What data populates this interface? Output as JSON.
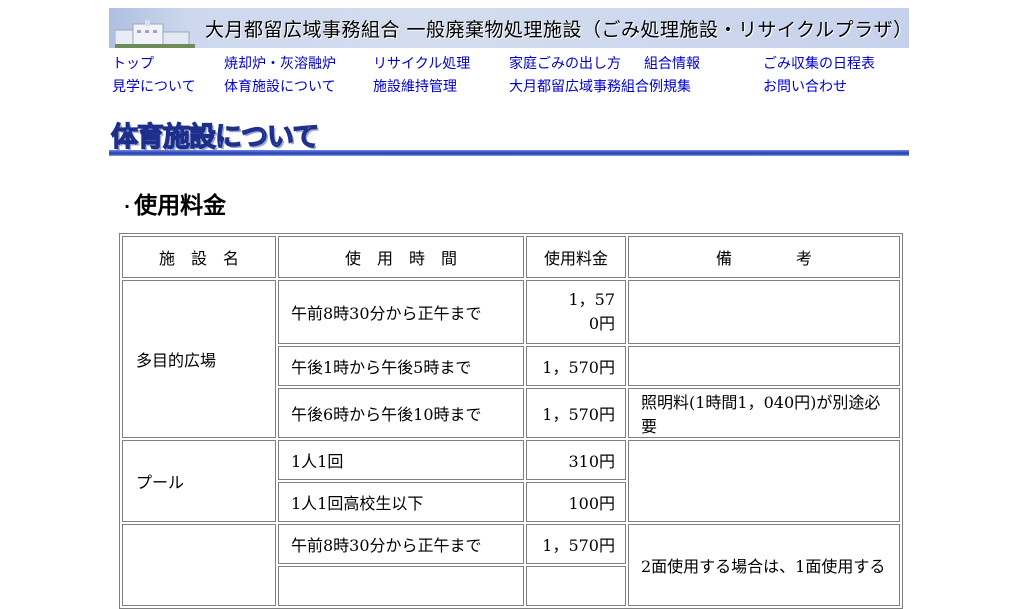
{
  "header": {
    "banner_title": "大月都留広域事務組合 一般廃棄物処理施設（ごみ処理施設・リサイクルプラザ）"
  },
  "nav": {
    "row1": [
      "トップ",
      "焼却炉・灰溶融炉",
      "リサイクル処理",
      "家庭ごみの出し方",
      "組合情報",
      "ごみ収集の日程表"
    ],
    "row2": [
      "見学について",
      "体育施設について",
      "施設維持管理",
      "大月都留広域事務組合例規集",
      "お問い合わせ"
    ]
  },
  "page_heading": "体育施設について",
  "section_title": "使用料金",
  "table": {
    "headers": [
      "施　設　名",
      "使　用　時　間",
      "使用料金",
      "備　　　　考"
    ],
    "rows": {
      "multipurpose": {
        "name": "多目的広場",
        "slots": [
          {
            "time": "午前8時30分から正午まで",
            "fee": "1，570円",
            "note": ""
          },
          {
            "time": "午後1時から午後5時まで",
            "fee": "1，570円",
            "note": ""
          },
          {
            "time": "午後6時から午後10時まで",
            "fee": "1，570円",
            "note": "照明料(1時間1，040円)が別途必要"
          }
        ]
      },
      "pool": {
        "name": "プール",
        "slots": [
          {
            "time": "1人1回",
            "fee": "310円"
          },
          {
            "time": "1人1回高校生以下",
            "fee": "100円"
          }
        ],
        "note": ""
      },
      "third": {
        "name": "",
        "slots": [
          {
            "time": "午前8時30分から正午まで",
            "fee": "1，570円"
          },
          {
            "time": "",
            "fee": ""
          }
        ],
        "note": "2面使用する場合は、1面使用する"
      }
    }
  }
}
